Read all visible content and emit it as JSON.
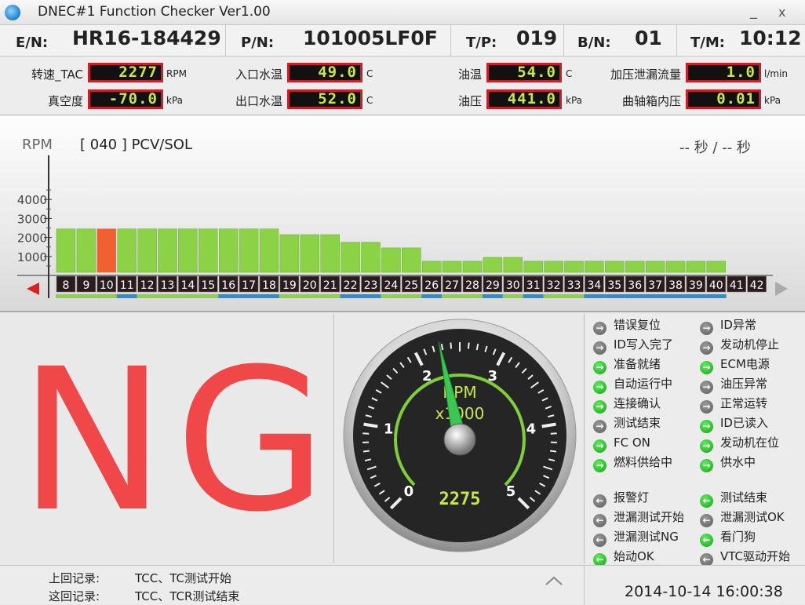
{
  "window": {
    "title": "DNEC#1 Function Checker Ver1.00",
    "min_glyph": "_",
    "close_glyph": "x"
  },
  "info": [
    {
      "label": "E/N:",
      "value": "HR16-184429"
    },
    {
      "label": "P/N:",
      "value": "101005LF0F"
    },
    {
      "label": "T/P:",
      "value": "019"
    },
    {
      "label": "B/N:",
      "value": "01"
    },
    {
      "label": "T/M:",
      "value": "10:12"
    }
  ],
  "sensors": [
    {
      "label": "转速_TAC",
      "value": "2277",
      "unit": "RPM"
    },
    {
      "label": "入口水温",
      "value": "49.0",
      "unit": "C"
    },
    {
      "label": "油温",
      "value": "54.0",
      "unit": "C"
    },
    {
      "label": "加压泄漏流量",
      "value": "1.0",
      "unit": "l/min"
    },
    {
      "label": "真空度",
      "value": "-70.0",
      "unit": "kPa"
    },
    {
      "label": "出口水温",
      "value": "52.0",
      "unit": "C"
    },
    {
      "label": "油压",
      "value": "441.0",
      "unit": "kPa"
    },
    {
      "label": "曲轴箱内压",
      "value": "0.01",
      "unit": "kPa"
    }
  ],
  "chart": {
    "ylabel": "RPM",
    "step_label": "[ 040 ] PCV/SOL",
    "time_label": "-- 秒 / -- 秒",
    "nav_left_icon": "triangle-left-icon",
    "nav_right_icon": "triangle-right-icon"
  },
  "chart_data": {
    "type": "bar",
    "ylabel": "RPM",
    "yticks": [
      1000,
      2000,
      3000,
      4000
    ],
    "ylim": [
      0,
      5000
    ],
    "categories": [
      "8",
      "9",
      "10",
      "11",
      "12",
      "13",
      "14",
      "15",
      "16",
      "17",
      "18",
      "19",
      "20",
      "21",
      "22",
      "23",
      "24",
      "25",
      "26",
      "27",
      "28",
      "29",
      "30",
      "31",
      "32",
      "33",
      "34",
      "35",
      "36",
      "37",
      "38",
      "39",
      "40",
      "41",
      "42"
    ],
    "values": [
      2450,
      2450,
      2450,
      2450,
      2450,
      2450,
      2450,
      2450,
      2450,
      2450,
      2450,
      2150,
      2150,
      2150,
      1750,
      1750,
      1450,
      1450,
      750,
      750,
      750,
      950,
      950,
      750,
      750,
      750,
      750,
      750,
      750,
      750,
      750,
      750,
      750,
      null,
      null
    ],
    "highlight_index": 2,
    "colors": {
      "bar": "#8cd247",
      "highlight": "#f06030",
      "under_green": "#8cd247",
      "under_blue": "#2a8fd0"
    },
    "underline": [
      "g",
      "g",
      "g",
      "b",
      "g",
      "g",
      "g",
      "g",
      "b",
      "b",
      "b",
      "g",
      "g",
      "g",
      "b",
      "b",
      "g",
      "g",
      "b",
      "g",
      "g",
      "b",
      "g",
      "b",
      "g",
      "g",
      "b",
      "b",
      "b",
      "b",
      "b",
      "b",
      "b",
      "",
      ""
    ]
  },
  "result": {
    "text": "NG",
    "color": "#f04848"
  },
  "gauge": {
    "unit_line1": "RPM",
    "unit_line2": "x1000",
    "readout": "2275",
    "value_rpm": 2275,
    "min": 0,
    "max": 5,
    "labels": [
      "0",
      "1",
      "2",
      "3",
      "4",
      "5"
    ]
  },
  "status_left": [
    {
      "label": "错误复位",
      "state": "gray",
      "icon": "arrow-right-icon"
    },
    {
      "label": "ID写入完了",
      "state": "gray",
      "icon": "arrow-right-icon"
    },
    {
      "label": "准备就绪",
      "state": "green",
      "icon": "arrow-right-icon"
    },
    {
      "label": "自动运行中",
      "state": "green",
      "icon": "arrow-right-icon"
    },
    {
      "label": "连接确认",
      "state": "green",
      "icon": "arrow-right-icon"
    },
    {
      "label": "测试结束",
      "state": "gray",
      "icon": "arrow-right-icon"
    },
    {
      "label": "FC ON",
      "state": "green",
      "icon": "arrow-right-icon"
    },
    {
      "label": "燃料供给中",
      "state": "green",
      "icon": "arrow-right-icon"
    }
  ],
  "status_right": [
    {
      "label": "ID异常",
      "state": "gray",
      "icon": "arrow-right-icon"
    },
    {
      "label": "发动机停止",
      "state": "gray",
      "icon": "arrow-right-icon"
    },
    {
      "label": "ECM电源",
      "state": "green",
      "icon": "arrow-right-icon"
    },
    {
      "label": "油压异常",
      "state": "gray",
      "icon": "arrow-right-icon"
    },
    {
      "label": "正常运转",
      "state": "gray",
      "icon": "arrow-right-icon"
    },
    {
      "label": "ID已读入",
      "state": "green",
      "icon": "arrow-right-icon"
    },
    {
      "label": "发动机在位",
      "state": "green",
      "icon": "arrow-right-icon"
    },
    {
      "label": "供水中",
      "state": "green",
      "icon": "arrow-right-icon"
    }
  ],
  "status_left_out": [
    {
      "label": "报警灯",
      "state": "gray",
      "icon": "arrow-left-icon"
    },
    {
      "label": "泄漏测试开始",
      "state": "gray",
      "icon": "arrow-left-icon"
    },
    {
      "label": "泄漏测试NG",
      "state": "gray",
      "icon": "arrow-left-icon"
    },
    {
      "label": "始动OK",
      "state": "green",
      "icon": "arrow-left-icon"
    }
  ],
  "status_right_out": [
    {
      "label": "测试结束",
      "state": "green",
      "icon": "arrow-left-icon"
    },
    {
      "label": "泄漏测试OK",
      "state": "gray",
      "icon": "arrow-left-icon"
    },
    {
      "label": "看门狗",
      "state": "green",
      "icon": "arrow-left-icon"
    },
    {
      "label": "VTC驱动开始",
      "state": "gray",
      "icon": "arrow-left-icon"
    }
  ],
  "footer": {
    "prev_label": "上回记录:",
    "prev_value": "TCC、TC测试开始",
    "curr_label": "这回记录:",
    "curr_value": "TCC、TCR测试结束",
    "datetime": "2014-10-14 16:00:38"
  }
}
